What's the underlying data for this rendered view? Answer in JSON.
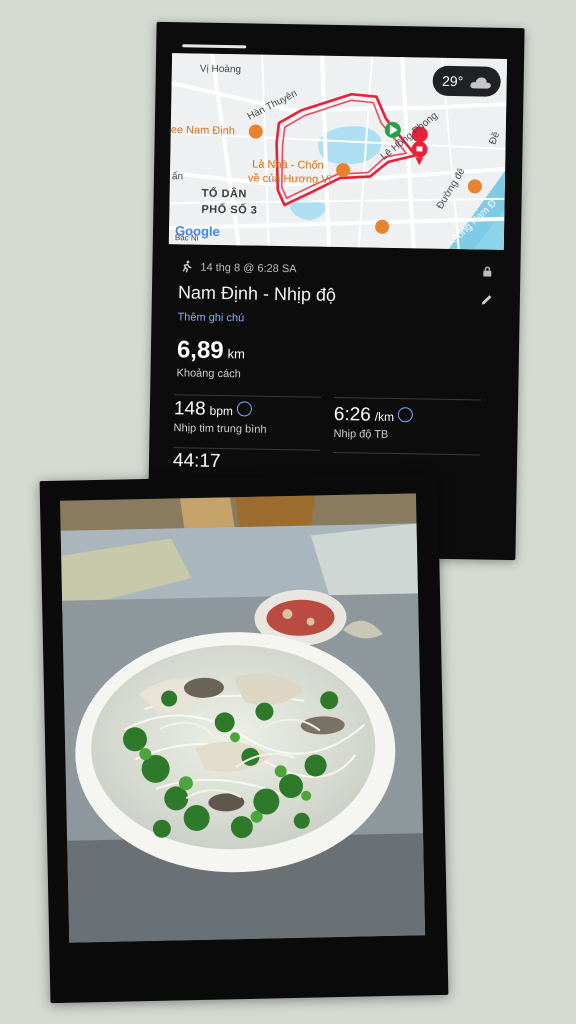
{
  "activity": {
    "weather": {
      "temp": "29°",
      "icon": "cloud-icon"
    },
    "map_labels": {
      "vi_hoang": "Vị Hoàng",
      "han_thuyen": "Hàn Thuyên",
      "nam_dinh_poi": "ee Nam Định",
      "la_nha": "Là Nhà - Chốn",
      "la_nha2": "về của Hương Vị",
      "le_hong_phong": "Lê Hồng Phong",
      "to_dan_pho": "TỔ DÂN",
      "to_dan_pho2": "PHỐ SỐ 3",
      "duong_de": "Đường đê",
      "song_nam": "Sông Nam Đ",
      "bac_ninh": "Bắc Ni",
      "google": "Google",
      "tan": "ấn",
      "de_right": "Đề"
    },
    "meta": {
      "run_icon": "running-icon",
      "datetime": "14 thg 8 @ 6:28 SA",
      "lock_icon": "lock-icon"
    },
    "title": "Nam Định - Nhịp độ",
    "add_note": "Thêm ghi chú",
    "distance": {
      "value": "6,89",
      "unit": "km",
      "label": "Khoảng cách"
    },
    "heart_rate": {
      "value": "148",
      "unit": "bpm",
      "label": "Nhịp tim trung bình"
    },
    "pace": {
      "value": "6:26",
      "unit": "/km",
      "label": "Nhịp độ TB"
    },
    "duration_partial": "44:17"
  },
  "photo": {
    "subject": "pho-bowl"
  }
}
